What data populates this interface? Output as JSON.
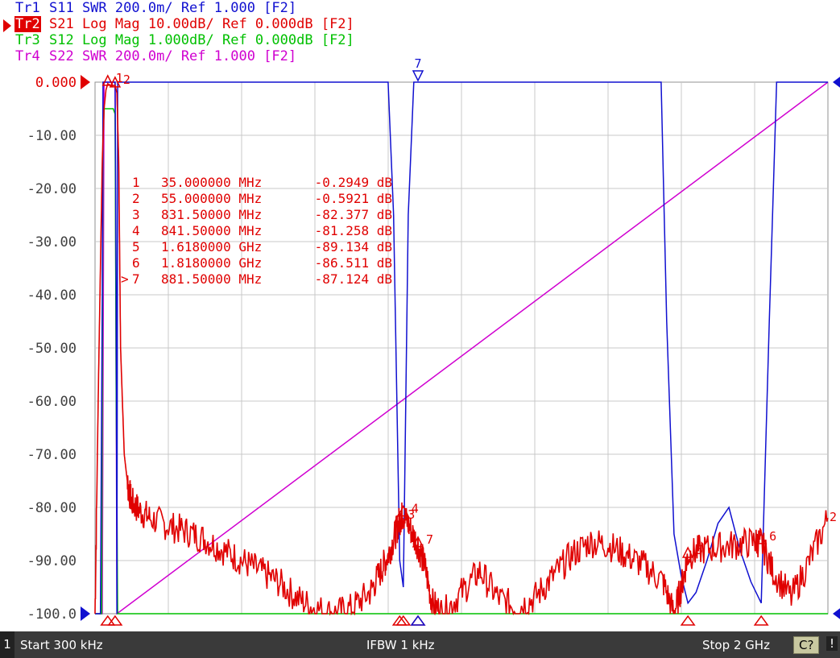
{
  "traces": [
    {
      "id": "Tr1",
      "param": "S11",
      "format": "SWR",
      "scale": "200.0m/",
      "ref": "Ref 1.000",
      "cursor": "[F2]",
      "color": "#1010d0",
      "active": false
    },
    {
      "id": "Tr2",
      "param": "S21",
      "format": "Log Mag",
      "scale": "10.00dB/",
      "ref": "Ref 0.000dB",
      "cursor": "[F2]",
      "color": "#e00000",
      "active": true
    },
    {
      "id": "Tr3",
      "param": "S12",
      "format": "Log Mag",
      "scale": "1.000dB/",
      "ref": "Ref 0.000dB",
      "cursor": "[F2]",
      "color": "#00c000",
      "active": false
    },
    {
      "id": "Tr4",
      "param": "S22",
      "format": "SWR",
      "scale": "200.0m/",
      "ref": "Ref 1.000",
      "cursor": "[F2]",
      "color": "#d000d0",
      "active": false
    }
  ],
  "status": {
    "channel": "1",
    "start": "Start 300 kHz",
    "ifbw": "IFBW 1 kHz",
    "stop": "Stop 2 GHz",
    "cal": "C?",
    "excl": "!"
  },
  "chart_data": {
    "type": "line",
    "x_unit": "MHz",
    "xlim": [
      0.3,
      2000
    ],
    "ylim": [
      -100,
      0
    ],
    "ylabel_unit": "dB",
    "y_ticks": [
      "0.000",
      "-10.00",
      "-20.00",
      "-30.00",
      "-40.00",
      "-50.00",
      "-60.00",
      "-70.00",
      "-80.00",
      "-90.00",
      "-100.0"
    ],
    "grid": true,
    "colors": {
      "s21": "#e00000",
      "s11": "#1010d0",
      "s12": "#00c000",
      "s22": "#d000d0",
      "grid": "#c8c8c8"
    },
    "marker_table": [
      {
        "num": "1",
        "freq": "35.000000 MHz",
        "value": "-0.2949 dB"
      },
      {
        "num": "2",
        "freq": "55.000000 MHz",
        "value": "-0.5921 dB"
      },
      {
        "num": "3",
        "freq": "831.50000 MHz",
        "value": "-82.377 dB"
      },
      {
        "num": "4",
        "freq": "841.50000 MHz",
        "value": "-81.258 dB"
      },
      {
        "num": "5",
        "freq": "1.6180000 GHz",
        "value": "-89.134 dB"
      },
      {
        "num": "6",
        "freq": "1.8180000 GHz",
        "value": "-86.511 dB"
      },
      {
        "num": "7",
        "freq": "881.50000 MHz",
        "value": "-87.124 dB",
        "active": true
      }
    ],
    "series": [
      {
        "name": "S21",
        "x": [
          0.3,
          10,
          20,
          25,
          30,
          35,
          40,
          45,
          50,
          55,
          60,
          65,
          70,
          80,
          90,
          100,
          120,
          150,
          200,
          250,
          300,
          350,
          400,
          450,
          500,
          550,
          600,
          650,
          700,
          750,
          780,
          800,
          820,
          831.5,
          841.5,
          860,
          881.5,
          900,
          920,
          950,
          1000,
          1050,
          1100,
          1150,
          1200,
          1250,
          1300,
          1350,
          1400,
          1450,
          1500,
          1550,
          1580,
          1600,
          1618,
          1650,
          1700,
          1750,
          1800,
          1818,
          1850,
          1900,
          1950,
          2000
        ],
        "y": [
          -100,
          -55,
          -15,
          -5,
          -1.5,
          -0.3,
          -0.5,
          -0.8,
          -0.6,
          -0.6,
          -2,
          -15,
          -50,
          -70,
          -76,
          -79,
          -80.5,
          -82,
          -83.5,
          -84.5,
          -86,
          -88,
          -90,
          -92,
          -94,
          -97,
          -99,
          -100,
          -99,
          -96,
          -92,
          -89,
          -85,
          -82.4,
          -81.3,
          -84,
          -87.1,
          -91,
          -98,
          -100,
          -96,
          -92,
          -97,
          -99,
          -97,
          -93,
          -89,
          -86.5,
          -87,
          -89,
          -91,
          -94,
          -100,
          -95,
          -89.1,
          -88,
          -87.5,
          -87,
          -86.5,
          -86.5,
          -92,
          -97,
          -90,
          -82
        ]
      },
      {
        "name": "S11",
        "x": [
          0.3,
          15,
          20,
          22,
          30,
          35,
          45,
          55,
          58,
          60,
          62,
          80,
          780,
          800,
          815,
          831.5,
          841.5,
          855,
          870,
          1500,
          1545,
          1560,
          1580,
          1600,
          1618,
          1640,
          1670,
          1700,
          1730,
          1760,
          1790,
          1818,
          1840,
          1860,
          2000
        ],
        "y": [
          -100,
          -100,
          -40,
          0,
          0,
          0,
          0,
          0,
          -40,
          -100,
          0,
          0,
          0,
          0,
          -25,
          -90,
          -95,
          -25,
          0,
          0,
          0,
          -45,
          -85,
          -93,
          -98,
          -96,
          -90,
          -83,
          -80,
          -88,
          -94,
          -98,
          -45,
          0,
          0
        ]
      },
      {
        "name": "S12",
        "x": [
          0.3,
          18,
          22,
          25,
          50,
          55,
          58,
          62,
          2000
        ],
        "y": [
          -100,
          -100,
          -10,
          -5,
          -5,
          -6,
          -60,
          -100,
          -100
        ]
      },
      {
        "name": "S22",
        "x": [
          0.3,
          20,
          25,
          55,
          60,
          2000
        ],
        "y": [
          -100,
          -100,
          0,
          0,
          -100,
          0
        ]
      }
    ],
    "markers": [
      {
        "num": "1",
        "x": 35,
        "y": -0.29,
        "trace": "S21"
      },
      {
        "num": "2",
        "x": 55,
        "y": -0.59,
        "trace": "S21"
      },
      {
        "num": "3",
        "x": 831.5,
        "y": -82.4,
        "trace": "S21"
      },
      {
        "num": "4",
        "x": 841.5,
        "y": -81.3,
        "trace": "S21"
      },
      {
        "num": "5",
        "x": 1618,
        "y": -89.1,
        "trace": "S21"
      },
      {
        "num": "6",
        "x": 1818,
        "y": -86.5,
        "trace": "S21"
      },
      {
        "num": "7",
        "x": 881.5,
        "y": -87.1,
        "trace": "S21"
      },
      {
        "num": "7",
        "x": 881.5,
        "y": 0,
        "trace": "S11"
      }
    ]
  }
}
